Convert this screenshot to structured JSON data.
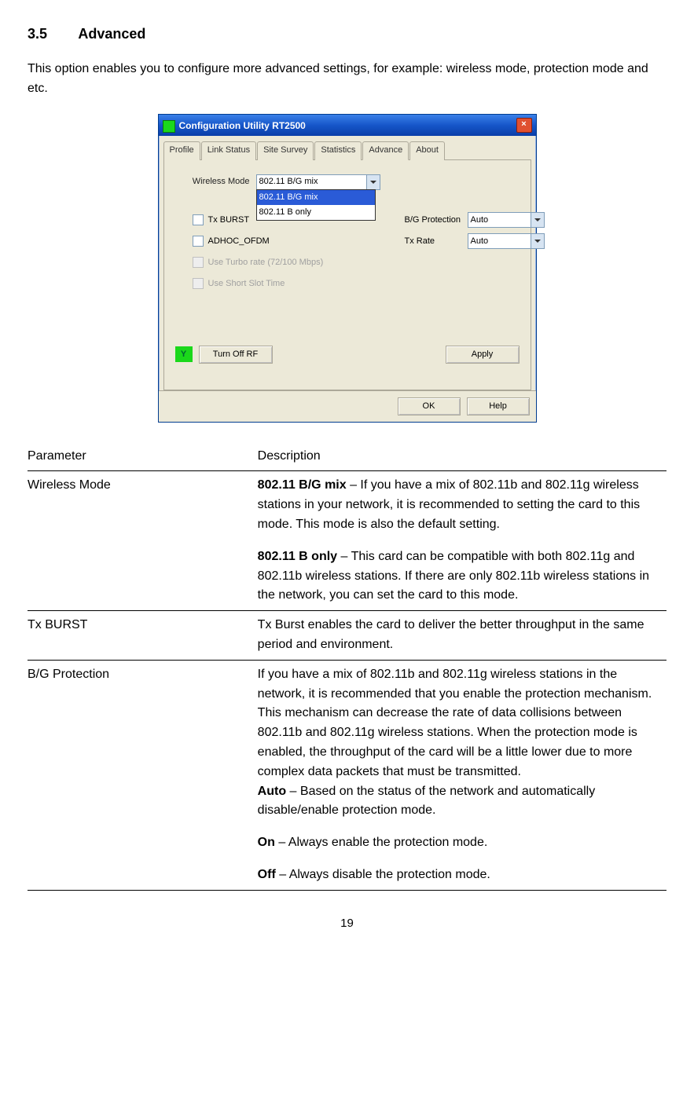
{
  "heading": {
    "num": "3.5",
    "title": "Advanced"
  },
  "intro": "This option enables you to configure more advanced settings, for example: wireless mode, protection mode and etc.",
  "win": {
    "title": "Configuration Utility RT2500",
    "tabs": [
      "Profile",
      "Link Status",
      "Site Survey",
      "Statistics",
      "Advance",
      "About"
    ],
    "active_tab": "Advance",
    "wireless_mode_label": "Wireless Mode",
    "wireless_mode_value": "802.11 B/G mix",
    "wireless_mode_opts": [
      "802.11 B/G mix",
      "802.11 B only"
    ],
    "txburst": "Tx BURST",
    "adhoc": "ADHOC_OFDM",
    "turbo": "Use Turbo rate (72/100 Mbps)",
    "shortslot": "Use Short Slot Time",
    "bgprot_label": "B/G Protection",
    "bgprot_value": "Auto",
    "txrate_label": "Tx Rate",
    "txrate_value": "Auto",
    "turnoff": "Turn Off RF",
    "apply": "Apply",
    "ok": "OK",
    "help": "Help"
  },
  "table": {
    "h_param": "Parameter",
    "h_desc": "Description",
    "rows": [
      {
        "param": "Wireless Mode",
        "bold1": "802.11 B/G mix",
        "text1": " – If you have a mix of 802.11b and 802.11g wireless stations in your network, it is recommended to setting the card to this mode. This mode is also the default setting.",
        "bold2": "802.11 B only",
        "text2": " – This card can be compatible with both 802.11g and 802.11b wireless stations. If there are only 802.11b wireless stations in the network, you can set the card to this mode."
      },
      {
        "param": "Tx BURST",
        "text1": "Tx Burst enables the card to deliver the better throughput in the same period and environment."
      },
      {
        "param": "B/G Protection",
        "text1": "If you have a mix of 802.11b and 802.11g wireless stations in the network, it is recommended that you enable the protection mechanism. This mechanism can decrease the rate of data collisions between 802.11b and 802.11g wireless stations. When the protection mode is enabled, the throughput of the card will be a little lower due to more complex data packets that must be transmitted.",
        "bold2": "Auto",
        "text2": " – Based on the status of the network and automatically disable/enable protection mode.",
        "bold3": "On",
        "text3": " – Always enable the protection mode.",
        "bold4": "Off",
        "text4": " – Always disable the protection mode."
      }
    ]
  },
  "pagenum": "19"
}
